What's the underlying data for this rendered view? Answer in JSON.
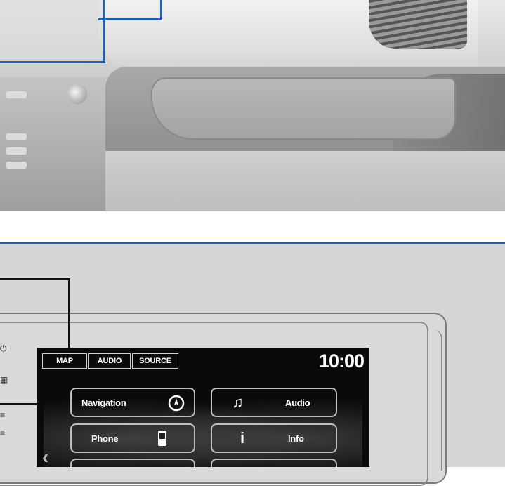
{
  "screen": {
    "tabs": [
      "MAP",
      "AUDIO",
      "SOURCE"
    ],
    "clock": "10:00",
    "menu": [
      {
        "label": "Navigation",
        "icon": "compass-icon"
      },
      {
        "label": "Audio",
        "icon": "music-note-icon"
      },
      {
        "label": "Phone",
        "icon": "phone-icon"
      },
      {
        "label": "Info",
        "icon": "info-icon"
      }
    ],
    "back_glyph": "‹"
  },
  "colors": {
    "callout_blue": "#1f5fb4",
    "screen_bg": "#0a0a0a",
    "diagram_bg": "#d6d6d6"
  }
}
